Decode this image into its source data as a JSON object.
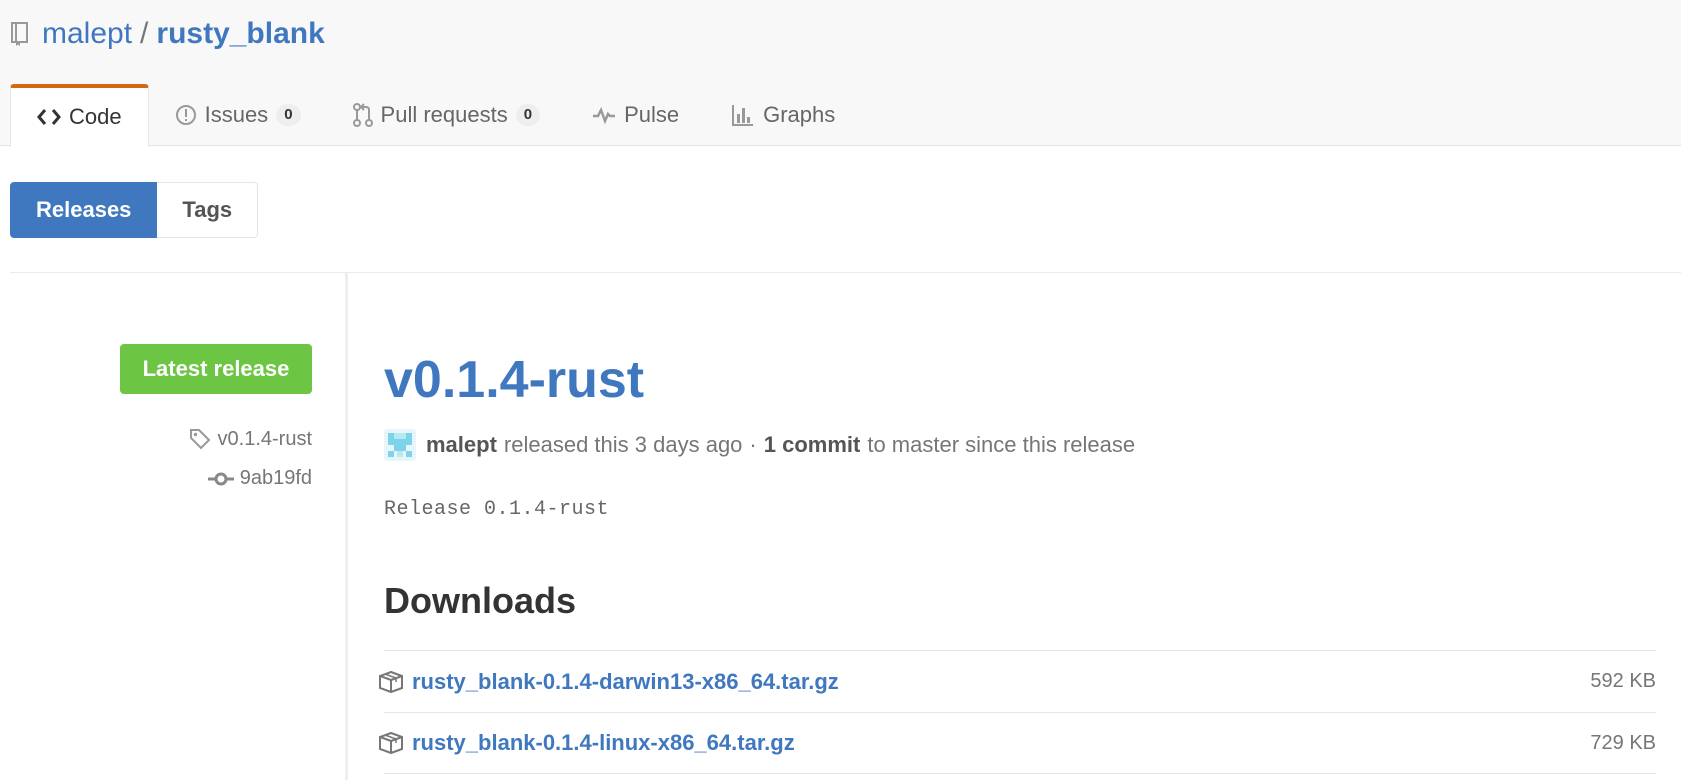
{
  "repo": {
    "owner": "malept",
    "separator": "/",
    "name": "rusty_blank",
    "icon": "repo-icon"
  },
  "tabs": [
    {
      "label": "Code",
      "icon": "code-icon",
      "selected": true
    },
    {
      "label": "Issues",
      "icon": "issue-opened-icon",
      "count": "0"
    },
    {
      "label": "Pull requests",
      "icon": "git-pull-request-icon",
      "count": "0"
    },
    {
      "label": "Pulse",
      "icon": "pulse-icon"
    },
    {
      "label": "Graphs",
      "icon": "graph-icon"
    }
  ],
  "subnav": {
    "releases_label": "Releases",
    "tags_label": "Tags"
  },
  "release": {
    "badge": "Latest release",
    "tag_name": "v0.1.4-rust",
    "commit_sha": "9ab19fd",
    "title": "v0.1.4-rust",
    "author": "malept",
    "released_text": "released this 3 days ago",
    "dot": "·",
    "commits_text": "1 commit",
    "since_text": "to master since this release",
    "body": "Release 0.1.4-rust"
  },
  "downloads": {
    "title": "Downloads",
    "files": [
      {
        "name": "rusty_blank-0.1.4-darwin13-x86_64.tar.gz",
        "size": "592 KB"
      },
      {
        "name": "rusty_blank-0.1.4-linux-x86_64.tar.gz",
        "size": "729 KB"
      }
    ]
  },
  "colors": {
    "link": "#4078c0",
    "badge_green": "#6cc644",
    "tab_accent": "#d26911"
  }
}
